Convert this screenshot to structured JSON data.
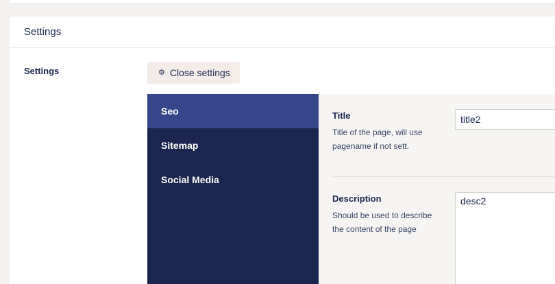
{
  "panel": {
    "header_title": "Settings",
    "row_label": "Settings"
  },
  "toolbar": {
    "close_settings_label": "Close settings",
    "close_settings_icon": "gear-icon"
  },
  "tabs": [
    {
      "label": "Seo",
      "active": true
    },
    {
      "label": "Sitemap",
      "active": false
    },
    {
      "label": "Social Media",
      "active": false
    }
  ],
  "fields": {
    "title": {
      "label": "Title",
      "description": "Title of the page, will use pagename if not sett.",
      "value": "title2"
    },
    "description": {
      "label": "Description",
      "description": "Should be used to describe the content of the page",
      "value": "desc2"
    }
  },
  "colors": {
    "nav_background": "#1b264f",
    "nav_active": "#35468a",
    "button_background": "#f3ece8",
    "content_background": "#f6f5f3"
  }
}
